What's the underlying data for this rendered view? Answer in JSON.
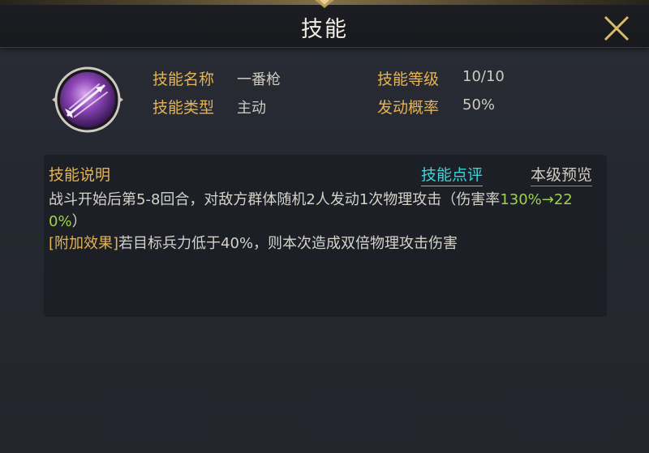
{
  "header": {
    "title": "技能"
  },
  "skill": {
    "icon": "arrow-skill-icon",
    "name_label": "技能名称",
    "name_value": "一番枪",
    "level_label": "技能等级",
    "level_value": "10/10",
    "type_label": "技能类型",
    "type_value": "主动",
    "chance_label": "发动概率",
    "chance_value": "50%"
  },
  "description": {
    "title": "技能说明",
    "review_tab": "技能点评",
    "preview_tab": "本级预览",
    "text_part1": "战斗开始后第5-8回合，对敌方群体随机2人发动1次物理攻击（伤害率",
    "text_highlight": "130%→220%",
    "text_part2": "）",
    "extra_label": "[附加效果]",
    "extra_text": "若目标兵力低于40%，则本次造成双倍物理攻击伤害"
  },
  "colors": {
    "label_gold": "#e3b355",
    "link_cyan": "#3fd3d8",
    "highlight_green": "#9fd24a",
    "icon_purple": "#7a3aa0"
  }
}
